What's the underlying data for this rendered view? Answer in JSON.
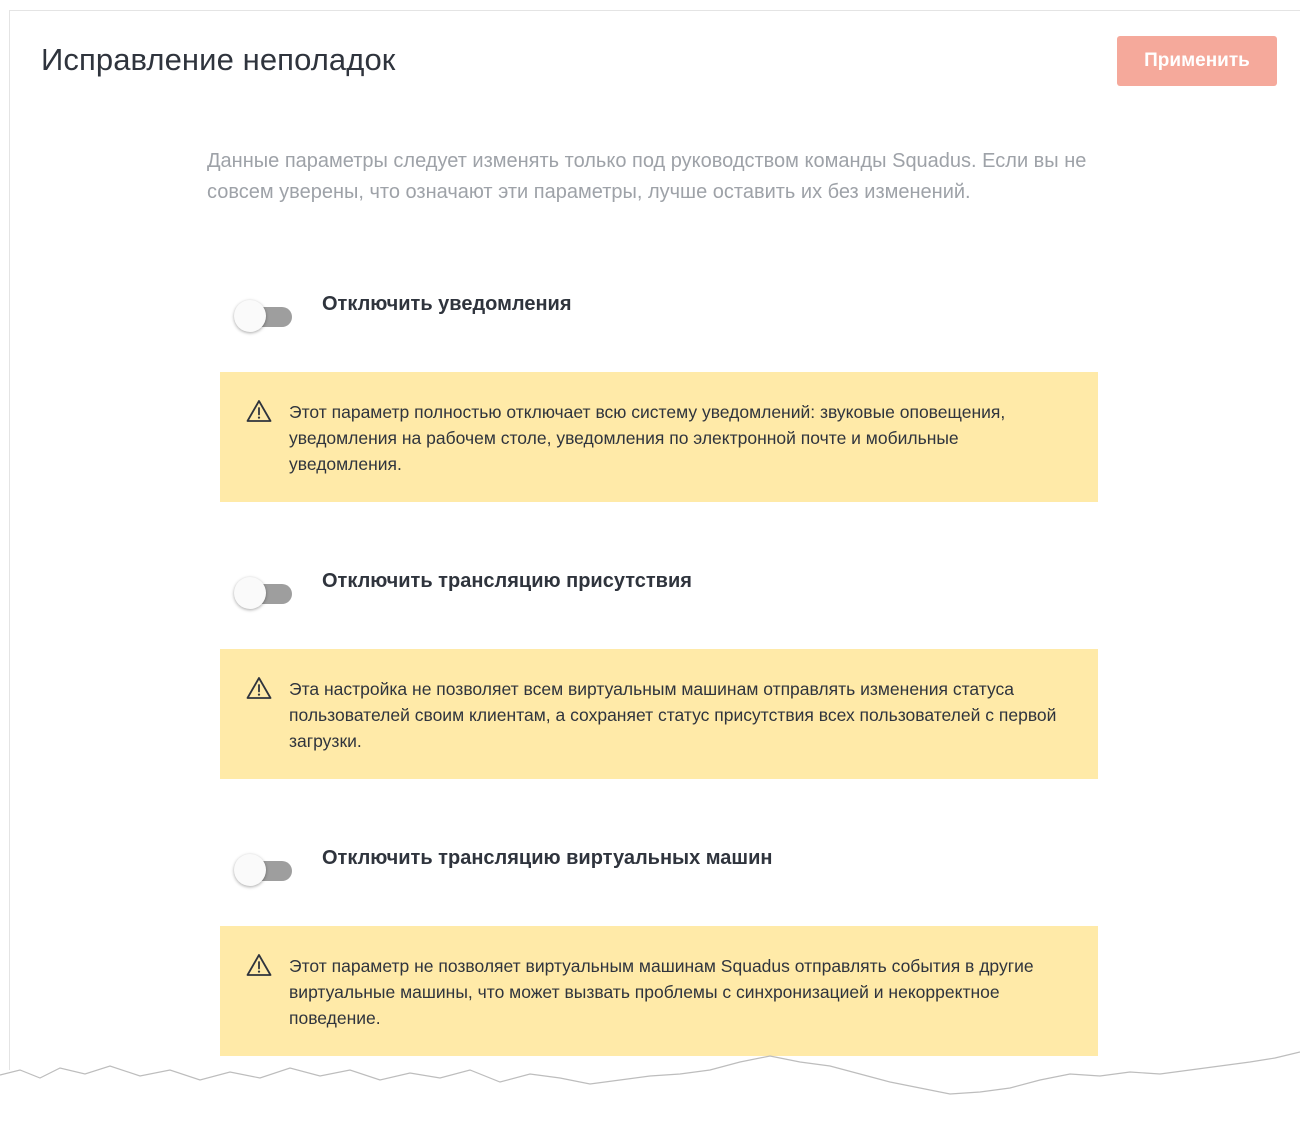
{
  "header": {
    "title": "Исправление неполадок",
    "apply_label": "Применить"
  },
  "intro_text": "Данные параметры следует изменять только под руководством команды Squadus. Если вы не совсем уверены, что означают эти параметры, лучше оставить их без изменений.",
  "settings": [
    {
      "label": "Отключить уведомления",
      "enabled": false,
      "warning": "Этот параметр полностью отключает всю систему уведомлений: звуковые оповещения, уведомления на рабочем столе, уведомления по электронной почте и мобильные уведомления."
    },
    {
      "label": "Отключить трансляцию присутствия",
      "enabled": false,
      "warning": "Эта настройка не позволяет всем виртуальным машинам отправлять изменения статуса пользователей своим клиентам, а сохраняет статус присутствия всех пользователей с первой загрузки."
    },
    {
      "label": "Отключить трансляцию виртуальных машин",
      "enabled": false,
      "warning": "Этот параметр не позволяет виртуальным машинам Squadus отправлять события в другие виртуальные машины, что может вызвать проблемы с синхронизацией и некорректное поведение."
    }
  ],
  "icons": {
    "warning": "warning-triangle-icon",
    "toggle": "toggle-switch"
  },
  "colors": {
    "apply_button": "#f5a99b",
    "warning_background": "#ffeaa8",
    "toggle_off": "#9e9e9e"
  }
}
